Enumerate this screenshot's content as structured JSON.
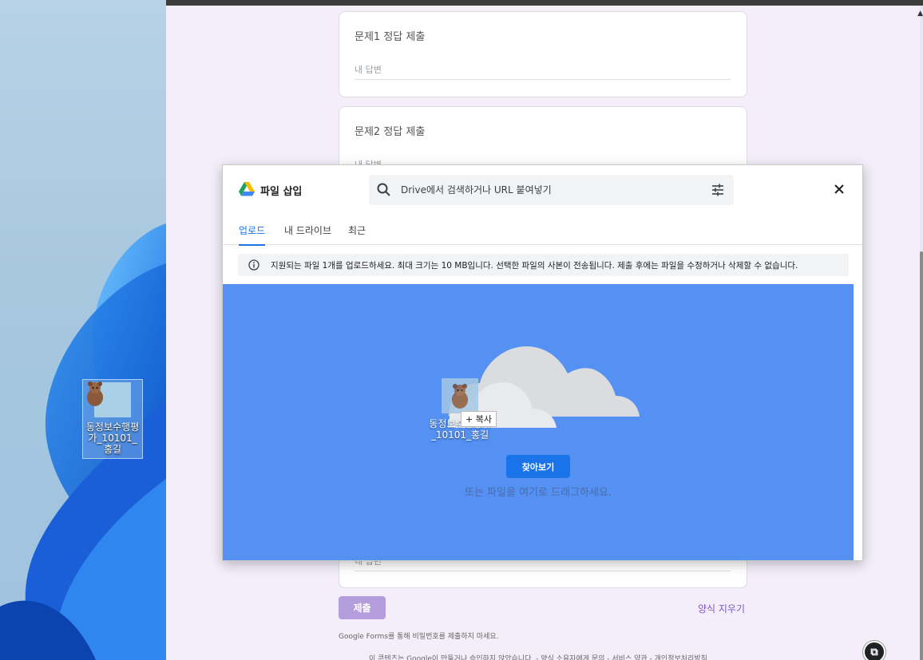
{
  "desktop": {
    "file_icon_label": "동정보수행평가_10101_홍길"
  },
  "form": {
    "questions": [
      {
        "title": "문제1 정답 제출",
        "placeholder": "내 답변"
      },
      {
        "title": "문제2 정답 제출",
        "placeholder": "내 답변"
      },
      {
        "title": "",
        "placeholder": "내 답변"
      }
    ],
    "submit_label": "제출",
    "clear_label": "양식 지우기",
    "footer_note": "Google Forms를 통해 비밀번호를 제출하지 마세요.",
    "footer_legal": "이 콘텐츠는 Google이 만들거나 승인하지 않았습니다. - 양식 소유자에게 문의 - 서비스 약관 - 개인정보처리방침"
  },
  "picker": {
    "title": "파일 삽입",
    "search_placeholder": "Drive에서 검색하거나 URL 붙여넣기",
    "tabs": [
      {
        "label": "업로드",
        "active": true
      },
      {
        "label": "내 드라이브",
        "active": false
      },
      {
        "label": "최근",
        "active": false
      }
    ],
    "info_text": "지원되는 파일 1개를 업로드하세요. 최대 크기는 10 MB입니다. 선택한 파일의 사본이 전송됩니다. 제출 후에는 파일을 수정하거나 삭제할 수 없습니다.",
    "browse_label": "찾아보기",
    "drag_hint": "또는 파일을 여기로 드래그하세요.",
    "drag_ghost_label": "동정보수행평가_10101_홍길",
    "copy_badge": "+ 복사"
  },
  "colors": {
    "accent": "#1a73e8",
    "dropzone": "#5591f2",
    "submit_disabled": "#b39ddb",
    "form_bg": "#f3eefa"
  }
}
